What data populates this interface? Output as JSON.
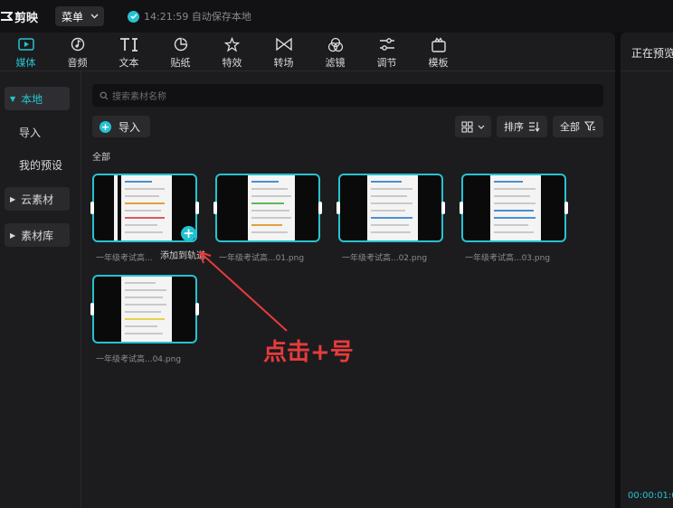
{
  "app": {
    "name": "剪映"
  },
  "header": {
    "menu_label": "菜单",
    "save_status": "14:21:59 自动保存本地"
  },
  "toolbar": [
    {
      "label": "媒体",
      "icon": "media-play-icon",
      "active": true
    },
    {
      "label": "音频",
      "icon": "music-note-icon",
      "active": false
    },
    {
      "label": "文本",
      "icon": "text-icon",
      "active": false
    },
    {
      "label": "贴纸",
      "icon": "sticker-icon",
      "active": false
    },
    {
      "label": "特效",
      "icon": "sparkle-star-icon",
      "active": false
    },
    {
      "label": "转场",
      "icon": "transition-bowtie-icon",
      "active": false
    },
    {
      "label": "滤镜",
      "icon": "filter-circles-icon",
      "active": false
    },
    {
      "label": "调节",
      "icon": "sliders-icon",
      "active": false
    },
    {
      "label": "模板",
      "icon": "template-box-icon",
      "active": false
    }
  ],
  "sidebar": {
    "items": [
      {
        "label": "本地",
        "type": "selected"
      },
      {
        "label": "导入",
        "type": "sub"
      },
      {
        "label": "我的预设",
        "type": "sub"
      },
      {
        "label": "云素材",
        "type": "group"
      },
      {
        "label": "素材库",
        "type": "group"
      }
    ]
  },
  "search": {
    "placeholder": "搜索素材名称"
  },
  "actions": {
    "import_label": "导入",
    "sort_label": "排序",
    "filter_label": "全部"
  },
  "section_label": "全部",
  "media": [
    {
      "caption": "一年级考试高..."
    },
    {
      "caption": "一年级考试高...01.png"
    },
    {
      "caption": "一年级考试高...02.png"
    },
    {
      "caption": "一年级考试高...03.png"
    },
    {
      "caption": "一年级考试高...04.png"
    }
  ],
  "tooltip": "添加到轨道",
  "annotation": "点击+号",
  "preview": {
    "title": "正在预览",
    "timecode": "00:00:01:0"
  },
  "colors": {
    "accent": "#27c2d0",
    "annotation": "#e83b3b",
    "panel": "#1c1c1f"
  }
}
